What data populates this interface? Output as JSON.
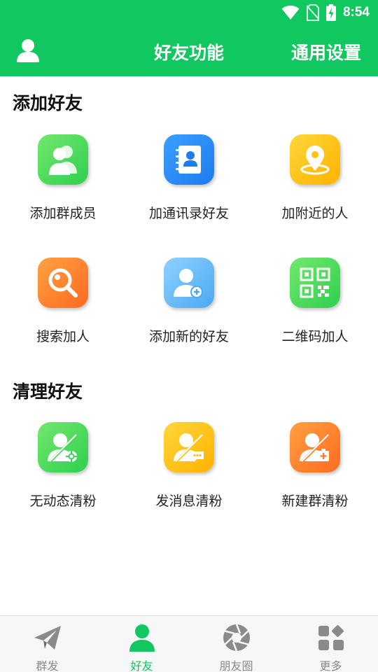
{
  "status_bar": {
    "time": "8:54",
    "icons": [
      "wifi-icon",
      "no-sim-icon",
      "battery-charging-icon"
    ]
  },
  "header": {
    "title": "好友功能",
    "settings_label": "通用设置",
    "avatar_icon": "user-icon"
  },
  "colors": {
    "brand": "#10c760",
    "nav_inactive": "#8a8a8a"
  },
  "sections": [
    {
      "title": "添加好友",
      "items": [
        {
          "label": "添加群成员",
          "icon": "group-members-icon",
          "color": "green"
        },
        {
          "label": "加通讯录好友",
          "icon": "contacts-book-icon",
          "color": "blue"
        },
        {
          "label": "加附近的人",
          "icon": "location-pin-icon",
          "color": "yellow"
        },
        {
          "label": "搜索加人",
          "icon": "search-icon",
          "color": "orange"
        },
        {
          "label": "添加新的好友",
          "icon": "add-user-icon",
          "color": "lightblue"
        },
        {
          "label": "二维码加人",
          "icon": "qr-code-icon",
          "color": "green"
        }
      ]
    },
    {
      "title": "清理好友",
      "items": [
        {
          "label": "无动态清粉",
          "icon": "user-no-moments-icon",
          "color": "green"
        },
        {
          "label": "发消息清粉",
          "icon": "user-message-icon",
          "color": "yellow"
        },
        {
          "label": "新建群清粉",
          "icon": "user-new-group-icon",
          "color": "orange"
        }
      ]
    }
  ],
  "bottom_nav": [
    {
      "label": "群发",
      "icon": "paper-plane-icon",
      "active": false
    },
    {
      "label": "好友",
      "icon": "user-icon",
      "active": true
    },
    {
      "label": "朋友圈",
      "icon": "camera-shutter-icon",
      "active": false
    },
    {
      "label": "更多",
      "icon": "more-grid-icon",
      "active": false
    }
  ]
}
